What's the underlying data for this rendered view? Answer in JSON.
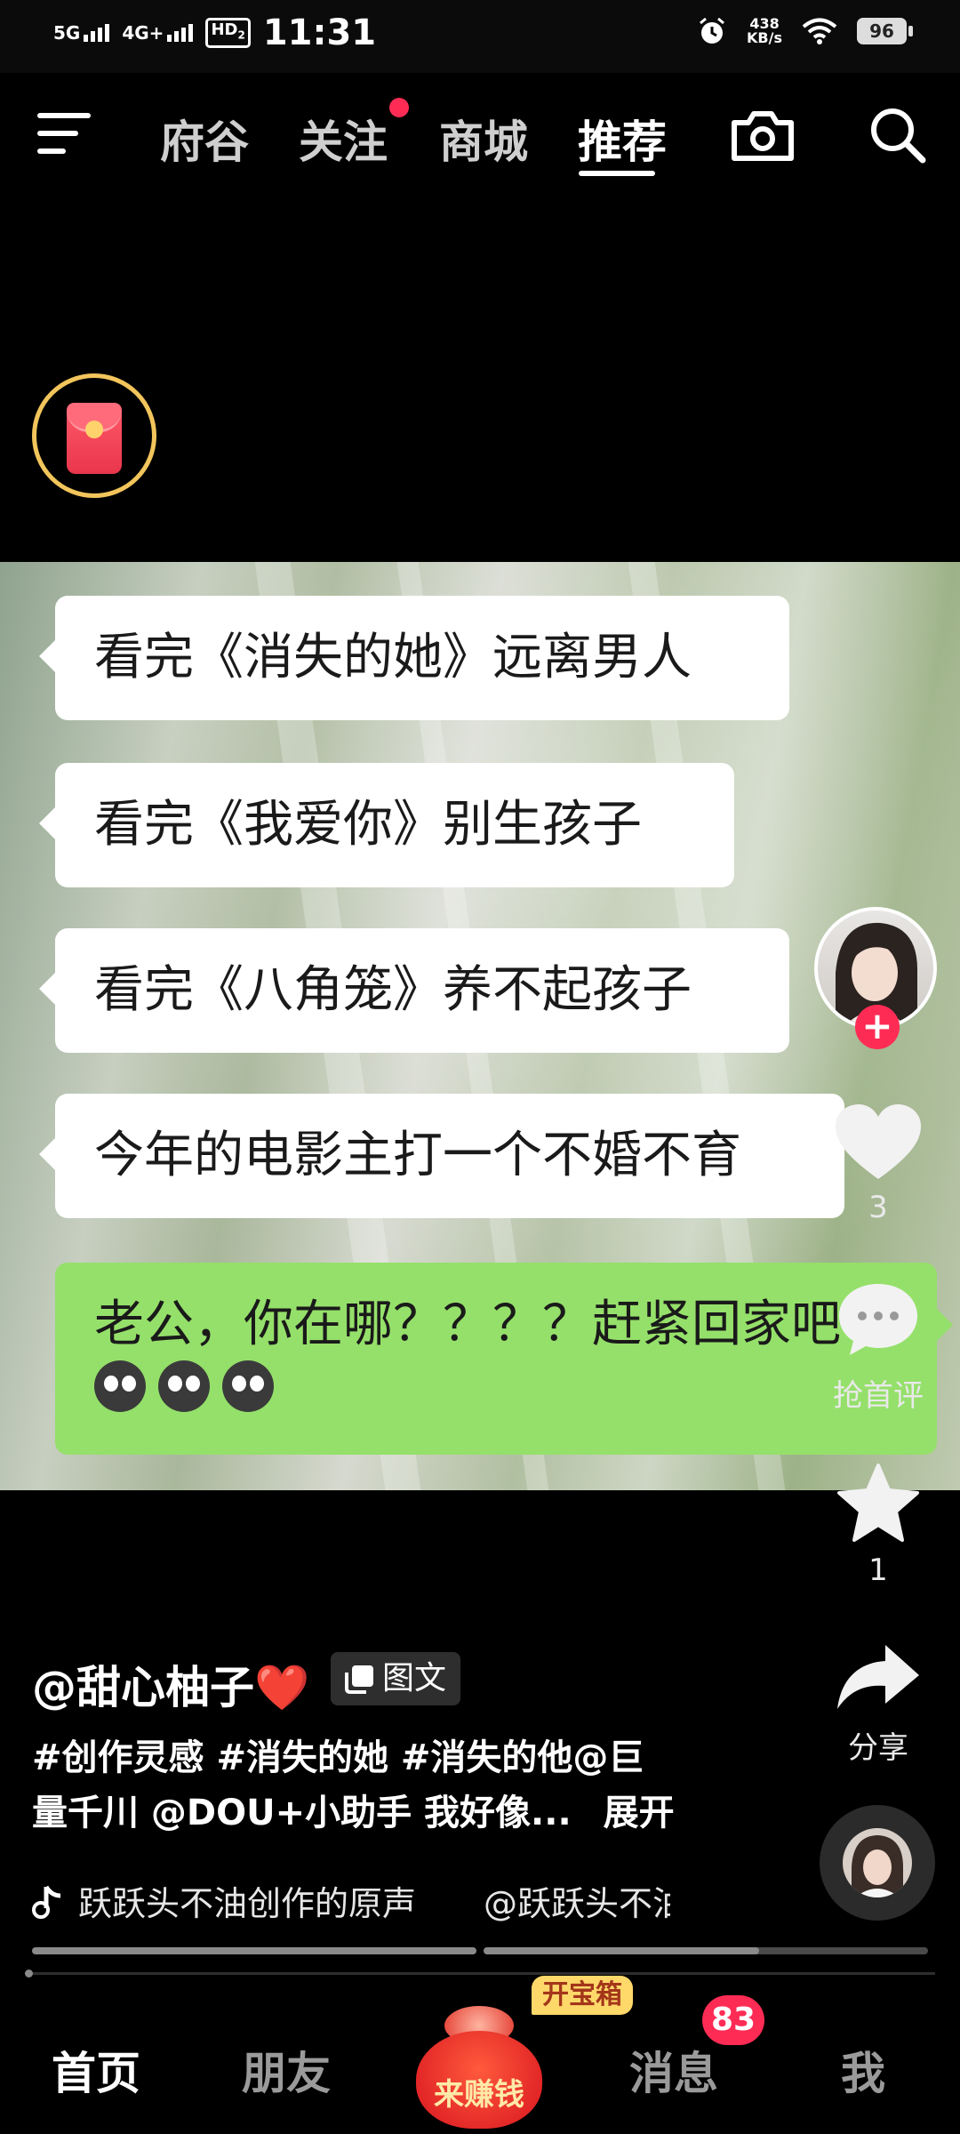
{
  "status_bar": {
    "net1": "5G",
    "net2": "4G+",
    "hd": "HD",
    "hd_sub": "2",
    "time": "11:31",
    "speed_value": "438",
    "speed_unit": "KB/s",
    "battery": "96"
  },
  "top_nav": {
    "tabs": [
      {
        "label": "府谷",
        "active": false
      },
      {
        "label": "关注",
        "active": false,
        "has_dot": true
      },
      {
        "label": "商城",
        "active": false
      },
      {
        "label": "推荐",
        "active": true
      }
    ],
    "icons": [
      "menu-icon",
      "camera-icon",
      "search-icon"
    ]
  },
  "post": {
    "bubbles": [
      "看完《消失的她》远离男人",
      "看完《我爱你》别生孩子",
      "看完《八角笼》养不起孩子",
      "今年的电影主打一个不婚不育"
    ],
    "green_bubble": "老公，你在哪？？？？赶紧回家吧",
    "emoji_count": 3
  },
  "rail": {
    "likes": "3",
    "comment_label": "抢首评",
    "favorites": "1",
    "share_label": "分享"
  },
  "info": {
    "author": "@甜心柚子❤️",
    "type_badge": "图文",
    "caption_line1": "#创作灵感 #消失的她 #消失的他@巨",
    "caption_line2": "量千川 @DOU+小助手 我好像...",
    "expand": "展开",
    "music_1": "跃跃头不油创作的原声",
    "music_2": "@跃跃头不油"
  },
  "bottom_nav": {
    "home": "首页",
    "friends": "朋友",
    "earn": "来赚钱",
    "treasure": "开宝箱",
    "messages": "消息",
    "messages_badge": "83",
    "me": "我"
  },
  "colors": {
    "accent_red": "#fe2c55",
    "chat_green": "#95e06a",
    "gold": "#f2c55c"
  }
}
